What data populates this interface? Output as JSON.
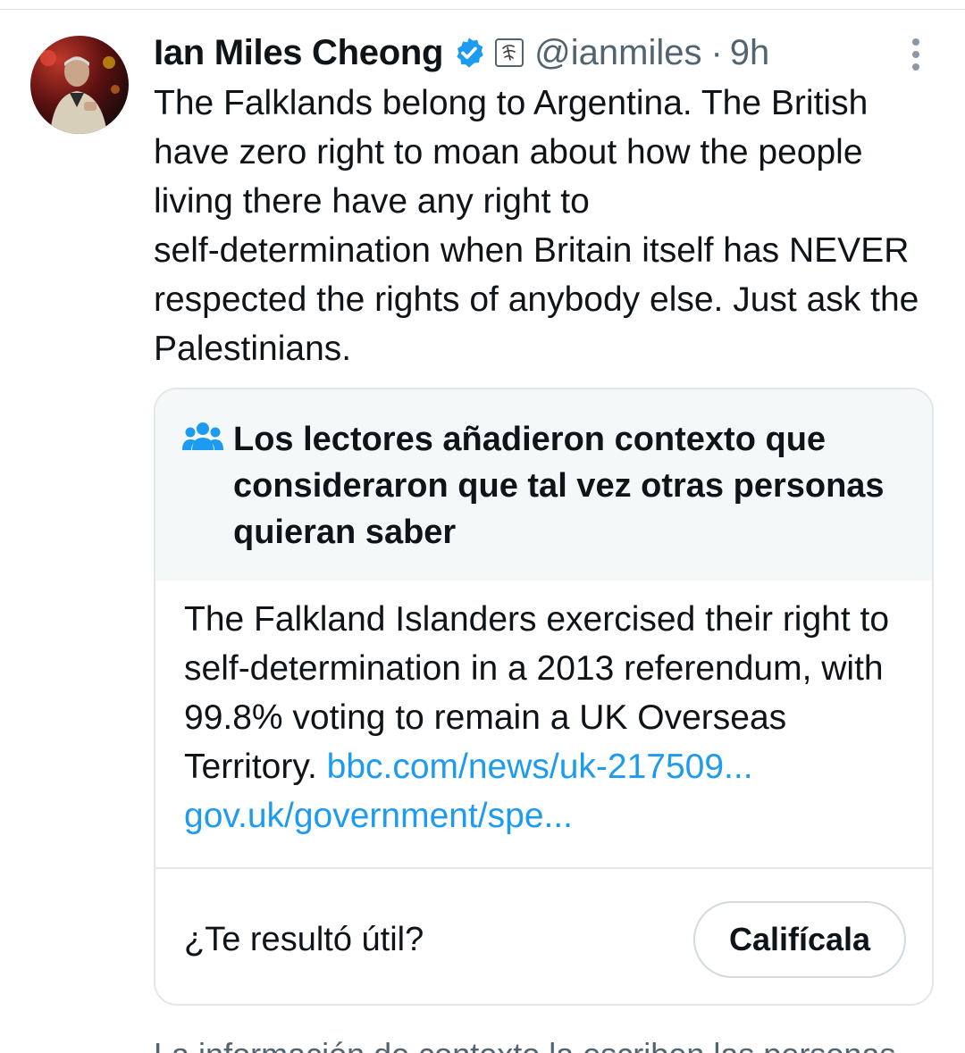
{
  "tweet": {
    "author_name": "Ian Miles Cheong",
    "handle": "@ianmiles",
    "separator": "·",
    "time": "9h",
    "text": "The Falklands belong to Argentina. The British have zero right to moan about how the people living there have any right to\nself-determination when Britain itself has NEVER respected the rights of anybody else. Just ask the Palestinians.",
    "icons": {
      "verified": "verified-badge-icon",
      "affiliate": "affiliate-badge-icon",
      "more": "more-options-icon",
      "avatar": "profile-photo"
    }
  },
  "community_note": {
    "title": "Los lectores añadieron contexto que consideraron que tal vez otras personas quieran saber",
    "body_text": "The Falkland Islanders exercised their right to self-determination in a 2013 referendum, with 99.8% voting to remain a UK Overseas Territory. ",
    "links": [
      "bbc.com/news/uk-217509...",
      "gov.uk/government/spe..."
    ],
    "helpful_question": "¿Te resultó útil?",
    "rate_button_label": "Califícala",
    "icon": "community-notes-icon"
  },
  "footer_partial_text": "La información de contexto la escriben las personas",
  "colors": {
    "link": "#1d9bf0",
    "verified": "#1d9bf0",
    "secondary_text": "#536471",
    "note_header_bg": "#f5f8f9",
    "border": "#e3e7ea"
  }
}
